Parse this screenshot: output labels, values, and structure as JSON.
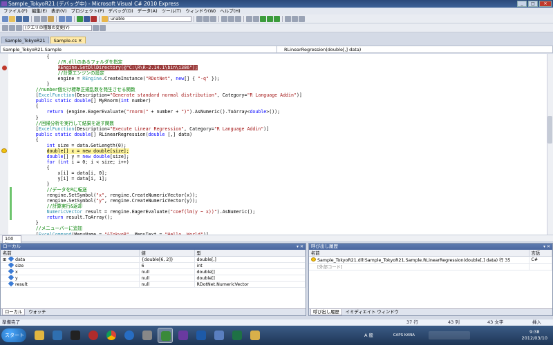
{
  "window": {
    "title": "Sample_TokyoR21 (デバッグ中) - Microsoft Visual C# 2010 Express",
    "minimize": "_",
    "maximize": "□",
    "close": "✕"
  },
  "menu": [
    "ファイル(F)",
    "編集(E)",
    "表示(V)",
    "プロジェクト(P)",
    "デバッグ(D)",
    "データ(A)",
    "ツール(T)",
    "ウィンドウ(W)",
    "ヘルプ(H)"
  ],
  "toolbar": {
    "search_combo": "unable",
    "placeholder": "(クエリの種類の変更(Y)"
  },
  "tabs": [
    "Sample_TokyoR21",
    "Sample.cs"
  ],
  "tab_close": "✕",
  "navbar": {
    "left": "Sample_TokyoR21.Sample",
    "right": "RLinearRegression(double[,] data)"
  },
  "code_lines": [
    {
      "indent": 12,
      "parts": [
        {
          "t": "{",
          "c": ""
        }
      ]
    },
    {
      "indent": 16,
      "parts": [
        {
          "t": "//R.dllのあるフォルダを指定",
          "c": "cm"
        }
      ]
    },
    {
      "indent": 16,
      "parts": [
        {
          "t": "REngine.SetDllDirectory(@\"C:\\R\\R-2.14.1\\bin\\i386\");",
          "c": "bp"
        }
      ],
      "bp": true
    },
    {
      "indent": 16,
      "parts": [
        {
          "t": "//計算エンジンの設定",
          "c": "cm"
        }
      ]
    },
    {
      "indent": 16,
      "parts": [
        {
          "t": "engine = ",
          "c": ""
        },
        {
          "t": "REngine",
          "c": "tp"
        },
        {
          "t": ".CreateInstance(",
          "c": ""
        },
        {
          "t": "\"RDotNet\"",
          "c": "st"
        },
        {
          "t": ", ",
          "c": ""
        },
        {
          "t": "new",
          "c": "kw"
        },
        {
          "t": "[] { ",
          "c": ""
        },
        {
          "t": "\"-q\"",
          "c": "st"
        },
        {
          "t": " });",
          "c": ""
        }
      ]
    },
    {
      "indent": 12,
      "parts": [
        {
          "t": "}",
          "c": ""
        }
      ]
    },
    {
      "indent": 8,
      "parts": [
        {
          "t": "//number個だけ標準正規乱数を発生させる関数",
          "c": "cm"
        }
      ]
    },
    {
      "indent": 8,
      "parts": [
        {
          "t": "[",
          "c": ""
        },
        {
          "t": "ExcelFunction",
          "c": "tp"
        },
        {
          "t": "(Description=",
          "c": ""
        },
        {
          "t": "\"Generate standard normal distribution\"",
          "c": "st"
        },
        {
          "t": ", Category=",
          "c": ""
        },
        {
          "t": "\"R Language Addin\"",
          "c": "st"
        },
        {
          "t": ")]",
          "c": ""
        }
      ]
    },
    {
      "indent": 8,
      "parts": [
        {
          "t": "public static double",
          "c": "kw"
        },
        {
          "t": "[] MyRnorm(",
          "c": ""
        },
        {
          "t": "int",
          "c": "kw"
        },
        {
          "t": " number)",
          "c": ""
        }
      ]
    },
    {
      "indent": 8,
      "parts": [
        {
          "t": "{",
          "c": ""
        }
      ]
    },
    {
      "indent": 12,
      "parts": [
        {
          "t": "return",
          "c": "kw"
        },
        {
          "t": " (engine.EagerEvaluate(",
          "c": ""
        },
        {
          "t": "\"rnorm(\"",
          "c": "st"
        },
        {
          "t": " + number + ",
          "c": ""
        },
        {
          "t": "\")\"",
          "c": "st"
        },
        {
          "t": ").AsNumeric().ToArray<",
          "c": ""
        },
        {
          "t": "double",
          "c": "kw"
        },
        {
          "t": ">());",
          "c": ""
        }
      ]
    },
    {
      "indent": 8,
      "parts": [
        {
          "t": "}",
          "c": ""
        }
      ]
    },
    {
      "indent": 8,
      "parts": [
        {
          "t": "//回帰分析を実行して結果を返す関数",
          "c": "cm"
        }
      ]
    },
    {
      "indent": 8,
      "parts": [
        {
          "t": "[",
          "c": ""
        },
        {
          "t": "ExcelFunction",
          "c": "tp"
        },
        {
          "t": "(Description=",
          "c": ""
        },
        {
          "t": "\"Execute Linear Regression\"",
          "c": "st"
        },
        {
          "t": ", Category=",
          "c": ""
        },
        {
          "t": "\"R Language Addin\"",
          "c": "st"
        },
        {
          "t": ")]",
          "c": ""
        }
      ]
    },
    {
      "indent": 8,
      "parts": [
        {
          "t": "public static double",
          "c": "kw"
        },
        {
          "t": "[] RLinearRegression(",
          "c": ""
        },
        {
          "t": "double",
          "c": "kw"
        },
        {
          "t": " [,] data)",
          "c": ""
        }
      ]
    },
    {
      "indent": 8,
      "parts": [
        {
          "t": "{",
          "c": ""
        }
      ]
    },
    {
      "indent": 12,
      "parts": [
        {
          "t": "int",
          "c": "kw"
        },
        {
          "t": " size = data.GetLength(0);",
          "c": ""
        }
      ]
    },
    {
      "indent": 12,
      "parts": [
        {
          "t": "double[] x = new double[size];",
          "c": "cur"
        }
      ],
      "current": true
    },
    {
      "indent": 12,
      "parts": [
        {
          "t": "double",
          "c": "kw"
        },
        {
          "t": "[] y = ",
          "c": ""
        },
        {
          "t": "new double",
          "c": "kw"
        },
        {
          "t": "[size];",
          "c": ""
        }
      ]
    },
    {
      "indent": 12,
      "parts": [
        {
          "t": "for",
          "c": "kw"
        },
        {
          "t": " (",
          "c": ""
        },
        {
          "t": "int",
          "c": "kw"
        },
        {
          "t": " i = 0; i < size; i++)",
          "c": ""
        }
      ]
    },
    {
      "indent": 12,
      "parts": [
        {
          "t": "{",
          "c": ""
        }
      ]
    },
    {
      "indent": 16,
      "parts": [
        {
          "t": "x[i] = data[i, 0];",
          "c": ""
        }
      ]
    },
    {
      "indent": 16,
      "parts": [
        {
          "t": "y[i] = data[i, 1];",
          "c": ""
        }
      ]
    },
    {
      "indent": 12,
      "parts": [
        {
          "t": "}",
          "c": ""
        }
      ]
    },
    {
      "indent": 12,
      "parts": [
        {
          "t": "//データをRに転送",
          "c": "cm"
        }
      ]
    },
    {
      "indent": 12,
      "parts": [
        {
          "t": "rengine.SetSymbol(",
          "c": ""
        },
        {
          "t": "\"x\"",
          "c": "st"
        },
        {
          "t": ", rengine.CreateNumericVector(x));",
          "c": ""
        }
      ]
    },
    {
      "indent": 12,
      "parts": [
        {
          "t": "rengine.SetSymbol(",
          "c": ""
        },
        {
          "t": "\"y\"",
          "c": "st"
        },
        {
          "t": ", rengine.CreateNumericVector(y));",
          "c": ""
        }
      ]
    },
    {
      "indent": 12,
      "parts": [
        {
          "t": "//計算実行&返却",
          "c": "cm"
        }
      ]
    },
    {
      "indent": 12,
      "parts": [
        {
          "t": "NumericVector",
          "c": "tp"
        },
        {
          "t": " result = rengine.EagerEvaluate(",
          "c": ""
        },
        {
          "t": "\"coef(lm(y ~ x))\"",
          "c": "st"
        },
        {
          "t": ").AsNumeric();",
          "c": ""
        }
      ]
    },
    {
      "indent": 12,
      "parts": [
        {
          "t": "return",
          "c": "kw"
        },
        {
          "t": " result.ToArray();",
          "c": ""
        }
      ]
    },
    {
      "indent": 8,
      "parts": [
        {
          "t": "}",
          "c": ""
        }
      ]
    },
    {
      "indent": 8,
      "parts": [
        {
          "t": "//メニューバーに追加",
          "c": "cm"
        }
      ]
    },
    {
      "indent": 8,
      "parts": [
        {
          "t": "[",
          "c": ""
        },
        {
          "t": "ExcelCommand",
          "c": "tp"
        },
        {
          "t": "(MenuName = ",
          "c": ""
        },
        {
          "t": "\"&TokyoR\"",
          "c": "st"
        },
        {
          "t": ", MenuText = ",
          "c": ""
        },
        {
          "t": "\"Hello, World\"",
          "c": "st"
        },
        {
          "t": ")]",
          "c": ""
        }
      ]
    }
  ],
  "zoom": "100 %",
  "locals": {
    "title": "ローカル",
    "pin": "▾ ✕",
    "columns": [
      "名前",
      "値",
      "型"
    ],
    "rows": [
      {
        "name": "data",
        "value": "{double[6, 2]}",
        "type": "double[,]",
        "expand": "⊞"
      },
      {
        "name": "size",
        "value": "6",
        "type": "int",
        "expand": ""
      },
      {
        "name": "x",
        "value": "null",
        "type": "double[]",
        "expand": ""
      },
      {
        "name": "y",
        "value": "null",
        "type": "double[]",
        "expand": ""
      },
      {
        "name": "result",
        "value": "null",
        "type": "RDotNet.NumericVector",
        "expand": ""
      }
    ],
    "tabs": [
      "ローカル",
      "ウォッチ"
    ]
  },
  "callstack": {
    "title": "呼び出し履歴",
    "pin": "▾ ✕",
    "columns": [
      "名前",
      "言語"
    ],
    "rows": [
      {
        "name": "Sample_TokyoR21.dll!Sample_TokyoR21.Sample.RLinearRegression(double[,] data) 行 35",
        "lang": "C#"
      },
      {
        "name": "[外部コード]",
        "lang": ""
      }
    ],
    "tabs": [
      "呼び出し履歴",
      "イミディエイト ウィンドウ"
    ]
  },
  "status": {
    "left": "準備完了",
    "line": "37 行",
    "col": "43 列",
    "char": "43 文字",
    "mode": "挿入"
  },
  "taskbar": {
    "start": "スタート",
    "ime": "A 般",
    "caps": "CAPS KANA",
    "time": "9:38",
    "date": "2012/03/10"
  }
}
